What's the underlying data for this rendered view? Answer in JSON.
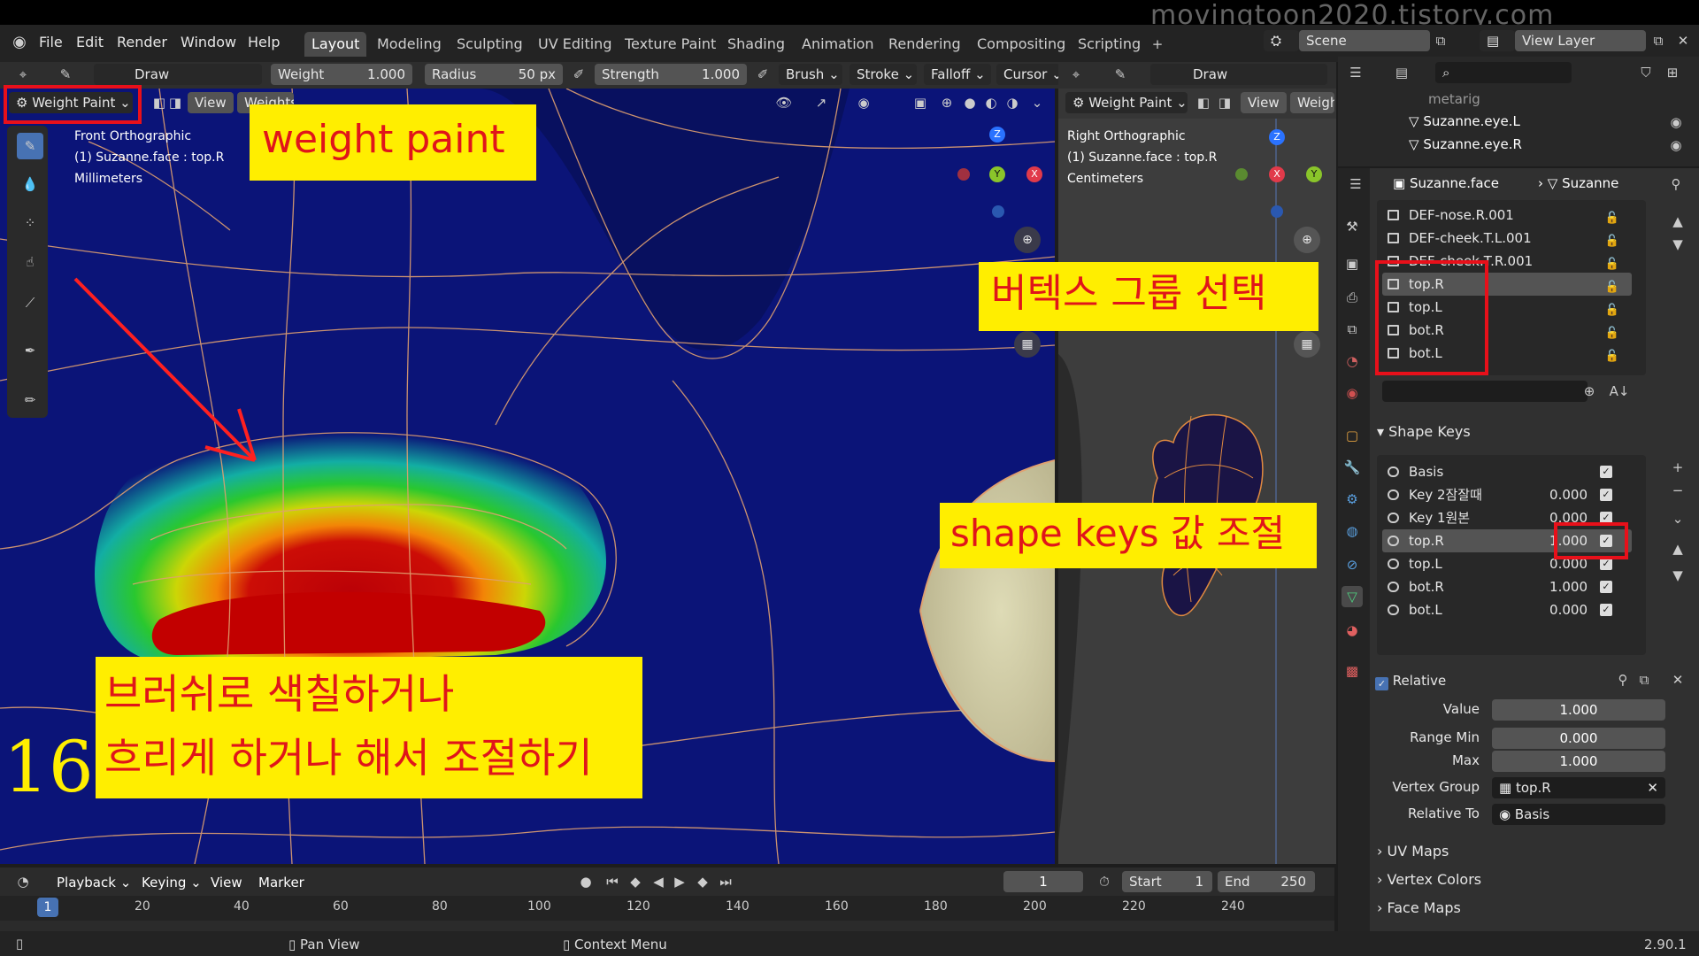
{
  "watermark": "movingtoon2020.tistory.com",
  "menu": [
    "File",
    "Edit",
    "Render",
    "Window",
    "Help"
  ],
  "workspace_tabs": [
    "Layout",
    "Modeling",
    "Sculpting",
    "UV Editing",
    "Texture Paint",
    "Shading",
    "Animation",
    "Rendering",
    "Compositing",
    "Scripting"
  ],
  "active_tab": "Layout",
  "scene": {
    "label": "Scene",
    "view_layer": "View Layer"
  },
  "tool_header": {
    "brush_name": "Draw",
    "weight_label": "Weight",
    "weight_value": "1.000",
    "radius_label": "Radius",
    "radius_value": "50 px",
    "strength_label": "Strength",
    "strength_value": "1.000",
    "brush_menu": "Brush",
    "stroke_menu": "Stroke",
    "falloff_menu": "Falloff",
    "cursor_menu": "Cursor"
  },
  "left_viewport": {
    "mode": "Weight Paint",
    "view_menu": "View",
    "weights_menu": "Weights",
    "info_line1": "Front Orthographic",
    "info_line2": "(1) Suzanne.face : top.R",
    "info_line3": "Millimeters"
  },
  "right_viewport": {
    "brush_name": "Draw",
    "mode": "Weight Paint",
    "view_menu": "View",
    "weights_menu": "Weigh",
    "info_line1": "Right Orthographic",
    "info_line2": "(1) Suzanne.face : top.R",
    "info_line3": "Centimeters"
  },
  "gizmo_axes": {
    "x": "X",
    "y": "Y",
    "z": "Z"
  },
  "annotations": {
    "weight_paint": "weight paint",
    "vertex_group_select": "버텍스 그룹 선택",
    "shape_keys_adjust": "shape keys 값 조절",
    "brush_line1": "브러쉬로 색칠하거나",
    "brush_line2": "흐리게 하거나 해서 조절하기",
    "step_number": "16"
  },
  "outliner": {
    "items": [
      {
        "label": "metarig"
      },
      {
        "label": "Suzanne.eye.L"
      },
      {
        "label": "Suzanne.eye.R"
      }
    ]
  },
  "properties": {
    "breadcrumb_object": "Suzanne.face",
    "breadcrumb_mesh": "Suzanne",
    "vertex_groups": [
      "DEF-nose.R.001",
      "DEF-cheek.T.L.001",
      "DEF-cheek.T.R.001",
      "top.R",
      "top.L",
      "bot.R",
      "bot.L"
    ],
    "selected_group": "top.R",
    "shape_keys_title": "Shape Keys",
    "shape_keys": [
      {
        "name": "Basis",
        "value": ""
      },
      {
        "name": "Key 2잠잘때",
        "value": "0.000"
      },
      {
        "name": "Key 1원본",
        "value": "0.000"
      },
      {
        "name": "top.R",
        "value": "1.000"
      },
      {
        "name": "top.L",
        "value": "0.000"
      },
      {
        "name": "bot.R",
        "value": "1.000"
      },
      {
        "name": "bot.L",
        "value": "0.000"
      }
    ],
    "relative_label": "Relative",
    "value_label": "Value",
    "value": "1.000",
    "range_min_label": "Range Min",
    "range_min": "0.000",
    "max_label": "Max",
    "max": "1.000",
    "vertex_group_label": "Vertex Group",
    "vertex_group": "top.R",
    "relative_to_label": "Relative To",
    "relative_to": "Basis",
    "collapsed_panels": [
      "UV Maps",
      "Vertex Colors",
      "Face Maps"
    ]
  },
  "timeline": {
    "playback": "Playback",
    "keying": "Keying",
    "view": "View",
    "marker": "Marker",
    "current_frame": "1",
    "start_label": "Start",
    "start": "1",
    "end_label": "End",
    "end": "250",
    "ticks": [
      "1",
      "20",
      "40",
      "60",
      "80",
      "100",
      "120",
      "140",
      "160",
      "180",
      "200",
      "220",
      "240"
    ]
  },
  "status_bar": {
    "pan": "Pan View",
    "context": "Context Menu",
    "version": "2.90.1"
  },
  "colors": {
    "accent_red": "#e8101a",
    "annotation_bg": "#ffee00",
    "viewport_blue": "#0b1478"
  }
}
